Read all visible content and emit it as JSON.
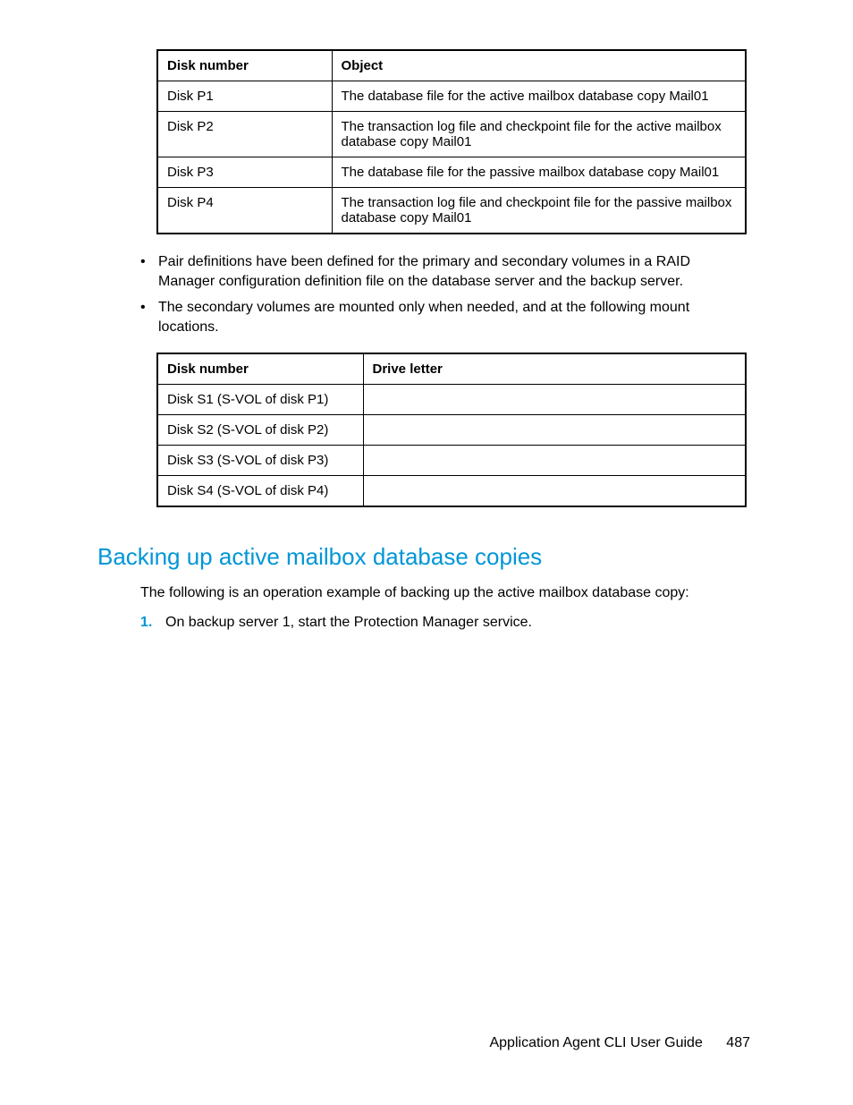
{
  "table1": {
    "headers": [
      "Disk number",
      "Object"
    ],
    "rows": [
      [
        "Disk P1",
        "The database file for the active mailbox database copy Mail01"
      ],
      [
        "Disk P2",
        "The transaction log file and checkpoint file for the active mailbox database copy Mail01"
      ],
      [
        "Disk P3",
        "The database file for the passive mailbox database copy Mail01"
      ],
      [
        "Disk P4",
        "The transaction log file and checkpoint file for the passive mailbox database copy Mail01"
      ]
    ]
  },
  "bullets": [
    "Pair definitions have been defined for the primary and secondary volumes in a RAID Manager configuration definition file on the database server and the backup server.",
    "The secondary volumes are mounted only when needed, and at the following mount locations."
  ],
  "table2": {
    "headers": [
      "Disk number",
      "Drive letter"
    ],
    "rows": [
      [
        "Disk S1 (S-VOL of disk P1)",
        ""
      ],
      [
        "Disk S2 (S-VOL of disk P2)",
        ""
      ],
      [
        "Disk S3 (S-VOL of disk P3)",
        ""
      ],
      [
        "Disk S4 (S-VOL of disk P4)",
        ""
      ]
    ]
  },
  "section_heading": "Backing up active mailbox database copies",
  "section_intro": "The following is an operation example of backing up the active mailbox database copy:",
  "steps": [
    {
      "num": "1.",
      "text": "On backup server 1, start the Protection Manager service."
    }
  ],
  "footer": {
    "title": "Application Agent CLI User Guide",
    "page": "487"
  }
}
